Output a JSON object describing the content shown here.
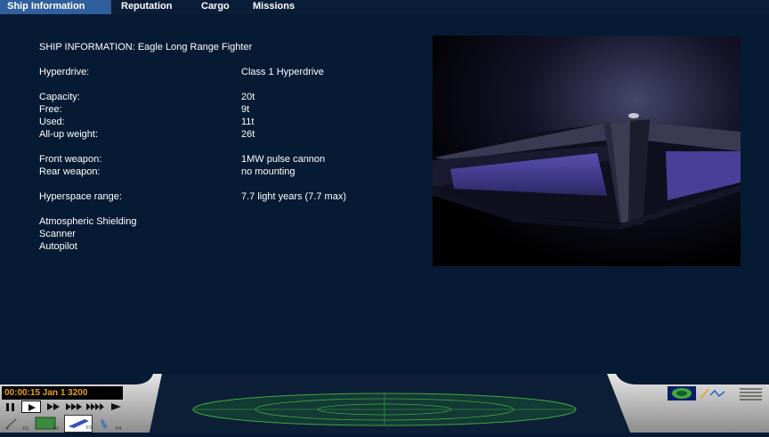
{
  "tabs": [
    {
      "label": "Ship Information",
      "active": true
    },
    {
      "label": "Reputation",
      "active": false
    },
    {
      "label": "Cargo",
      "active": false
    },
    {
      "label": "Missions",
      "active": false
    }
  ],
  "ship": {
    "title": "SHIP INFORMATION:  Eagle Long Range Fighter",
    "hyperdrive_label": "Hyperdrive:",
    "hyperdrive_value": "Class 1 Hyperdrive",
    "capacity_label": "Capacity:",
    "capacity_value": "20t",
    "free_label": "Free:",
    "free_value": "9t",
    "used_label": "Used:",
    "used_value": "11t",
    "allup_label": "All-up weight:",
    "allup_value": "26t",
    "front_weapon_label": "Front weapon:",
    "front_weapon_value": "1MW pulse cannon",
    "rear_weapon_label": "Rear weapon:",
    "rear_weapon_value": "no mounting",
    "hyperspace_label": "Hyperspace range:",
    "hyperspace_value": "7.7 light years (7.7 max)",
    "equipment": [
      "Atmospheric Shielding",
      "Scanner",
      "Autopilot"
    ]
  },
  "console": {
    "clock": "00:00:15 Jan 1 3200",
    "function_keys": [
      "F1",
      "F2",
      "F3",
      "F4"
    ],
    "colors": {
      "clock_text": "#e8a21e",
      "scanner_grid": "#3fa83f",
      "active_tab": "#2f5f9c"
    }
  }
}
